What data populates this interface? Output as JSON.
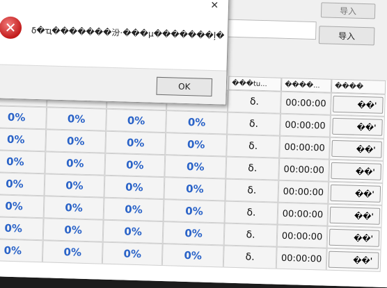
{
  "toolbar": {
    "export_label": "导入",
    "import_label": "导入"
  },
  "table": {
    "headers": [
      "���tu...",
      "����...",
      "����"
    ],
    "rows": [
      {
        "c1": "0%",
        "c2": "0%",
        "c3": "0%",
        "c4": "0%",
        "status": "δ.",
        "time": "00:00:00",
        "action": "��'"
      },
      {
        "c1": "0%",
        "c2": "0%",
        "c3": "0%",
        "c4": "0%",
        "status": "δ.",
        "time": "00:00:00",
        "action": "��'"
      },
      {
        "c1": "0%",
        "c2": "0%",
        "c3": "0%",
        "c4": "0%",
        "status": "δ.",
        "time": "00:00:00",
        "action": "��'"
      },
      {
        "c1": "0%",
        "c2": "0%",
        "c3": "0%",
        "c4": "0%",
        "status": "δ.",
        "time": "00:00:00",
        "action": "��'"
      },
      {
        "c1": "0%",
        "c2": "0%",
        "c3": "0%",
        "c4": "0%",
        "status": "δ.",
        "time": "00:00:00",
        "action": "��'"
      },
      {
        "c1": "0%",
        "c2": "0%",
        "c3": "0%",
        "c4": "0%",
        "status": "δ.",
        "time": "00:00:00",
        "action": "��'"
      },
      {
        "c1": "0%",
        "c2": "0%",
        "c3": "0%",
        "c4": "0%",
        "status": "δ.",
        "time": "00:00:00",
        "action": "��'"
      },
      {
        "c1": "0%",
        "c2": "0%",
        "c3": "0%",
        "c4": "0%",
        "status": "δ.",
        "time": "00:00:00",
        "action": "��'"
      }
    ]
  },
  "dialog": {
    "close": "✕",
    "icon": "error-icon",
    "message": "δ�ҵ�������汾·���µ�������ļ�",
    "ok_label": "OK"
  },
  "colors": {
    "percent": "#2a63c8",
    "error": "#c21b1b"
  }
}
